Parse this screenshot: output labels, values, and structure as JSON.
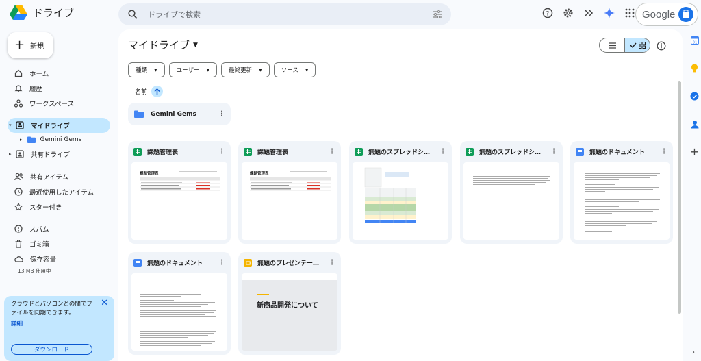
{
  "app": {
    "title": "ドライブ"
  },
  "search": {
    "placeholder": "ドライブで検索"
  },
  "account": {
    "name": "Google"
  },
  "new_button": {
    "label": "新規"
  },
  "sidebar": {
    "items": [
      {
        "label": "ホーム",
        "icon": "home-icon"
      },
      {
        "label": "履歴",
        "icon": "bell-icon"
      },
      {
        "label": "ワークスペース",
        "icon": "workspace-icon"
      },
      {
        "label": "マイドライブ",
        "icon": "my-drive-icon"
      },
      {
        "label": "Gemini Gems",
        "icon": "folder-icon"
      },
      {
        "label": "共有ドライブ",
        "icon": "shared-drive-icon"
      },
      {
        "label": "共有アイテム",
        "icon": "people-icon"
      },
      {
        "label": "最近使用したアイテム",
        "icon": "clock-icon"
      },
      {
        "label": "スター付き",
        "icon": "star-icon"
      },
      {
        "label": "スパム",
        "icon": "spam-icon"
      },
      {
        "label": "ゴミ箱",
        "icon": "trash-icon"
      },
      {
        "label": "保存容量",
        "icon": "cloud-icon"
      }
    ],
    "storage_used": "13 MB 使用中"
  },
  "promo": {
    "text": "クラウドとパソコンとの間でファイルを同期できます。",
    "link": "詳細",
    "button": "ダウンロード"
  },
  "main": {
    "title": "マイドライブ",
    "filters": [
      "種類",
      "ユーザー",
      "最終更新",
      "ソース"
    ],
    "sort_label": "名前",
    "folder": {
      "name": "Gemini Gems"
    },
    "files": [
      {
        "name": "課題管理表",
        "type": "sheet"
      },
      {
        "name": "課題管理表",
        "type": "sheet"
      },
      {
        "name": "無題のスプレッドシ…",
        "type": "sheet"
      },
      {
        "name": "無題のスプレッドシ…",
        "type": "sheet"
      },
      {
        "name": "無題のドキュメント",
        "type": "doc"
      },
      {
        "name": "無題のドキュメント",
        "type": "doc"
      },
      {
        "name": "無題のプレゼンテー…",
        "type": "slide"
      }
    ],
    "thumb_sheet_title": "課題管理表",
    "thumb_slide_title": "新商品開発について"
  },
  "colors": {
    "accent": "#c2e7ff",
    "link": "#0b57d0",
    "sheet": "#0f9d58",
    "doc": "#4285f4",
    "slide": "#f4b400"
  }
}
